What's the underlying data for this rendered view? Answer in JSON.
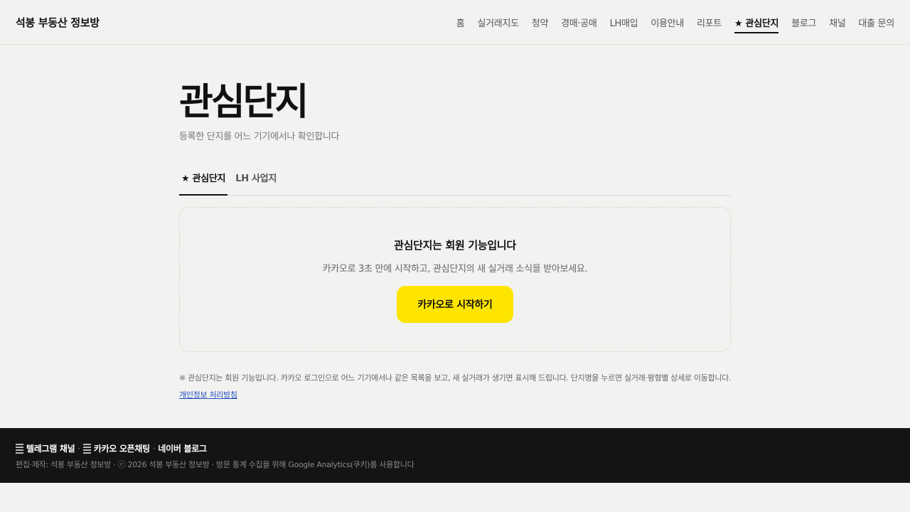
{
  "header": {
    "brand": "석봉 부동산 정보방",
    "nav": [
      {
        "label": "홈"
      },
      {
        "label": "실거래지도"
      },
      {
        "label": "청약"
      },
      {
        "label": "경매·공매"
      },
      {
        "label": "LH매입"
      },
      {
        "label": "이용안내"
      },
      {
        "label": "리포트"
      },
      {
        "label": "★ 관심단지",
        "active": true
      },
      {
        "label": "블로그"
      },
      {
        "label": "채널"
      },
      {
        "label": "대출 문의"
      }
    ]
  },
  "main": {
    "title": "관심단지",
    "subtitle": "등록한 단지를 어느 기기에서나 확인합니다",
    "tabs": [
      {
        "label": "★ 관심단지",
        "active": true
      },
      {
        "label": "LH 사업지"
      }
    ],
    "card": {
      "title": "관심단지는 회원 기능입니다",
      "description": "카카오로 3초 만에 시작하고, 관심단지의 새 실거래 소식을 받아보세요.",
      "button_label": "카카오로 시작하기"
    },
    "notice": "※ 관심단지는 회원 기능입니다. 카카오 로그인으로 어느 기기에서나 같은 목록을 보고, 새 실거래가 생기면 표시해 드립니다. 단지명을 누르면 실거래·평형별 상세로 이동합니다.",
    "privacy_link": "개인정보 처리방침"
  },
  "footer": {
    "links": [
      {
        "label": "텔레그램 채널",
        "icon": "document-icon"
      },
      {
        "label": "카카오 오픈채팅",
        "icon": "document-icon"
      },
      {
        "label": "네이버 블로그"
      }
    ],
    "separator": "·",
    "note": "편집·제작: 석봉 부동산 정보방 · ⓒ 2026 석봉 부동산 정보방 · 방문 통계 수집을 위해 Google Analytics(쿠키)를 사용합니다"
  },
  "colors": {
    "background": "#f2f2f0",
    "kakao_yellow": "#fee500",
    "footer_bg": "#141414",
    "link_blue": "#1f4fbf"
  }
}
